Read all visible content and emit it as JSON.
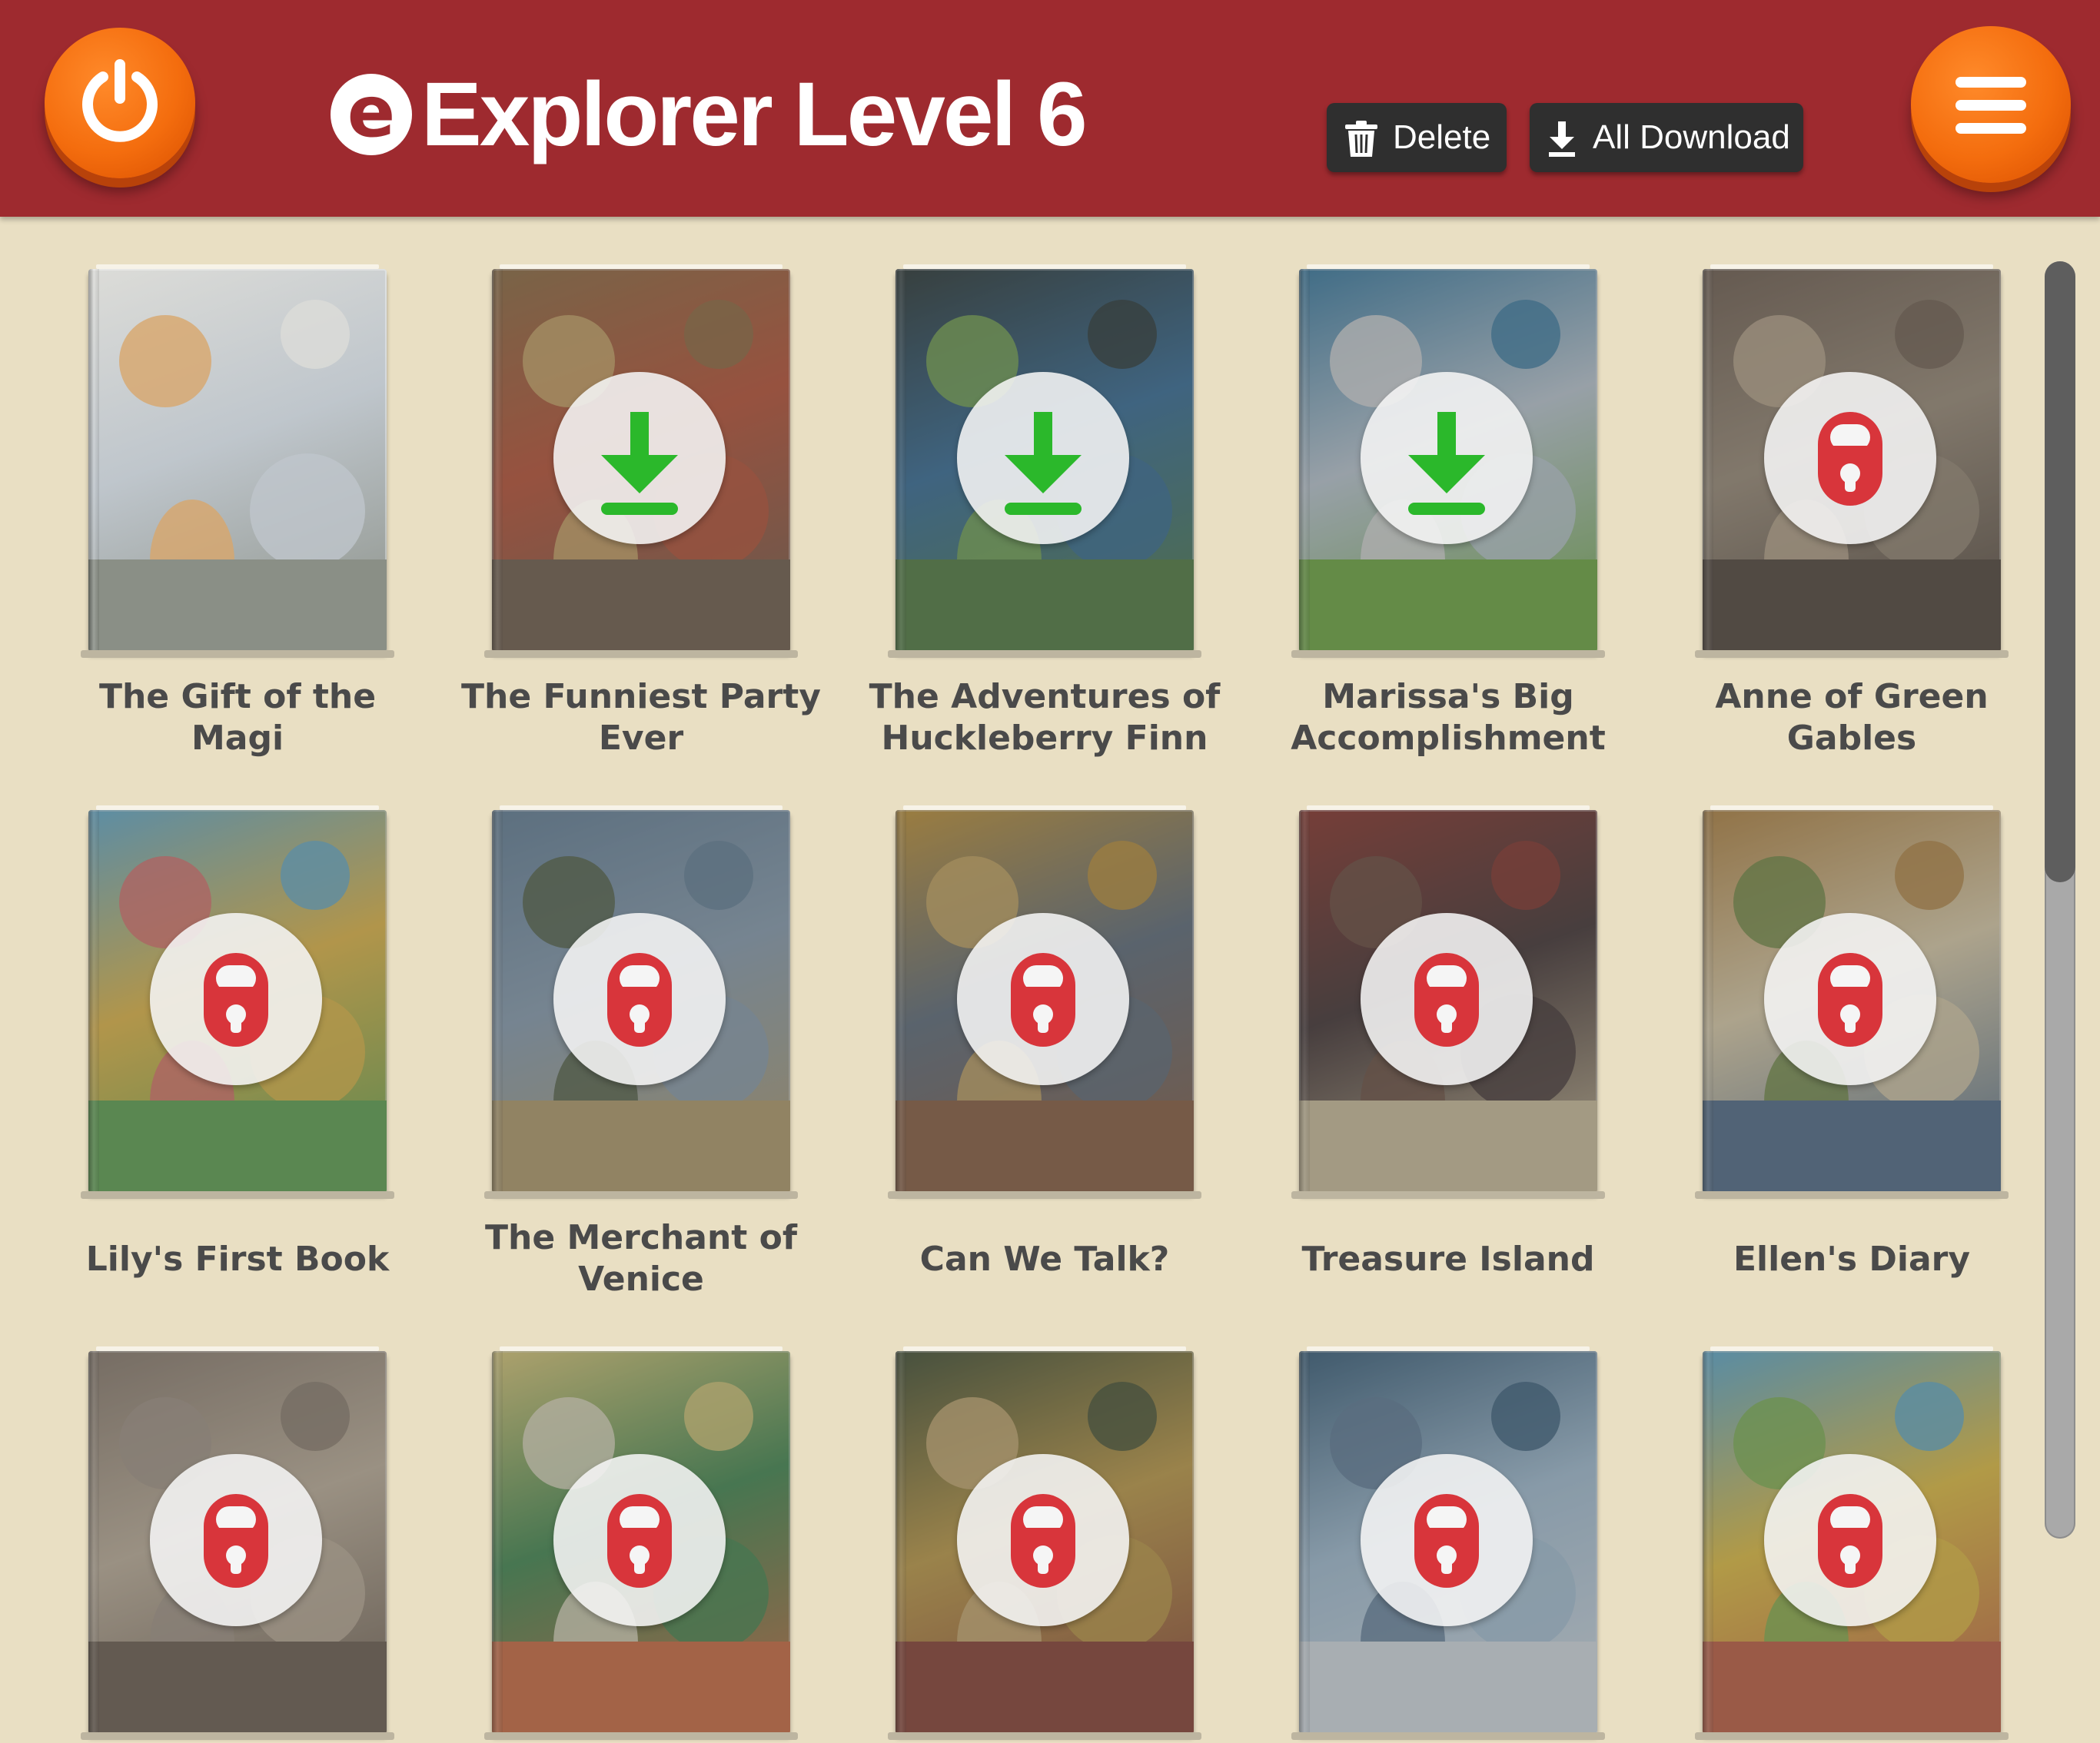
{
  "header": {
    "logo_letter": "e",
    "title": "Explorer Level 6",
    "delete_label": "Delete",
    "download_all_label": "All Download",
    "power_icon": "power-icon",
    "menu_icon": "hamburger-menu-icon"
  },
  "colors": {
    "header_bg": "#9e2a2f",
    "page_bg": "#e9dfc3",
    "accent_orange": "#f46d0e",
    "download_green": "#2bb82b",
    "lock_red": "#d8353b"
  },
  "books": [
    {
      "title": "The Gift of the Magi",
      "state": "available",
      "icon": "none"
    },
    {
      "title": "The Funniest Party Ever",
      "state": "download",
      "icon": "download-icon"
    },
    {
      "title": "The Adventures of Huckleberry Finn",
      "state": "download",
      "icon": "download-icon"
    },
    {
      "title": "Marissa's Big Accomplishment",
      "state": "download",
      "icon": "download-icon"
    },
    {
      "title": "Anne of Green Gables",
      "state": "locked",
      "icon": "lock-icon"
    },
    {
      "title": "Lily's First Book",
      "state": "locked",
      "icon": "lock-icon"
    },
    {
      "title": "The Merchant of Venice",
      "state": "locked",
      "icon": "lock-icon"
    },
    {
      "title": "Can We Talk?",
      "state": "locked",
      "icon": "lock-icon"
    },
    {
      "title": "Treasure Island",
      "state": "locked",
      "icon": "lock-icon"
    },
    {
      "title": "Ellen's Diary",
      "state": "locked",
      "icon": "lock-icon"
    },
    {
      "title": "",
      "state": "locked",
      "icon": "lock-icon"
    },
    {
      "title": "",
      "state": "locked",
      "icon": "lock-icon"
    },
    {
      "title": "",
      "state": "locked",
      "icon": "lock-icon"
    },
    {
      "title": "",
      "state": "locked",
      "icon": "lock-icon"
    },
    {
      "title": "",
      "state": "locked",
      "icon": "lock-icon"
    }
  ]
}
